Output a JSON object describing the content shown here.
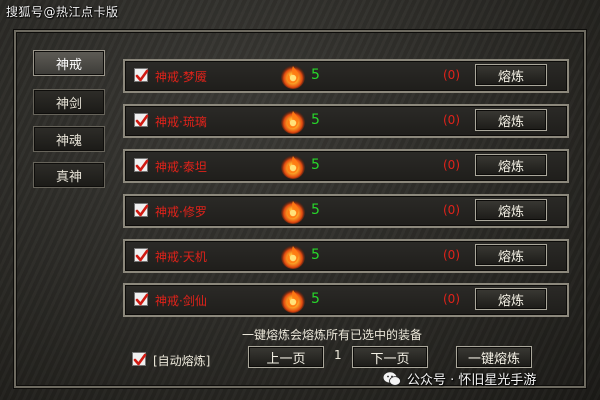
{
  "watermark_top": "搜狐号@热江点卡版",
  "side_tabs": [
    {
      "label": "神戒",
      "active": true
    },
    {
      "label": "神剑",
      "active": false
    },
    {
      "label": "神魂",
      "active": false
    },
    {
      "label": "真神",
      "active": false
    }
  ],
  "rows": [
    {
      "name": "神戒·梦魇",
      "checked": true,
      "count": "5",
      "selected": "(0)",
      "button": "熔炼"
    },
    {
      "name": "神戒·琉璃",
      "checked": true,
      "count": "5",
      "selected": "(0)",
      "button": "熔炼"
    },
    {
      "name": "神戒·泰坦",
      "checked": true,
      "count": "5",
      "selected": "(0)",
      "button": "熔炼"
    },
    {
      "name": "神戒·修罗",
      "checked": true,
      "count": "5",
      "selected": "(0)",
      "button": "熔炼"
    },
    {
      "name": "神戒·天机",
      "checked": true,
      "count": "5",
      "selected": "(0)",
      "button": "熔炼"
    },
    {
      "name": "神戒·剑仙",
      "checked": true,
      "count": "5",
      "selected": "(0)",
      "button": "熔炼"
    }
  ],
  "footer": {
    "hint": "一键熔炼会熔炼所有已选中的装备",
    "auto_smelt_label": "[自动熔炼]",
    "auto_smelt_checked": true,
    "prev_page": "上一页",
    "page_number": "1",
    "next_page": "下一页",
    "one_click_smelt": "一键熔炼"
  },
  "watermark_bottom": "公众号 · 怀旧星光手游",
  "colors": {
    "item_name": "#e0221a",
    "count": "#27d62a",
    "selected_count": "#e0221a",
    "button_text": "#f5f2e6",
    "check_mark": "#d01a12"
  },
  "icons": {
    "row_gem": "fire-gem-icon",
    "checkbox": "checkmark-icon",
    "wechat": "wechat-icon"
  }
}
